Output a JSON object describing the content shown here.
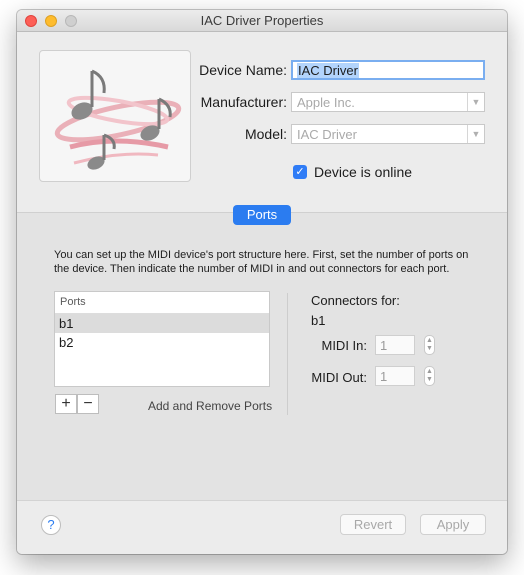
{
  "window": {
    "title": "IAC Driver Properties"
  },
  "device": {
    "name_label": "Device Name:",
    "name_value": "IAC Driver",
    "manufacturer_label": "Manufacturer:",
    "manufacturer_value": "Apple Inc.",
    "model_label": "Model:",
    "model_value": "IAC Driver",
    "online_label": "Device is online",
    "online_checked": true,
    "icon": "midi-notes-icon"
  },
  "tabs": {
    "ports_label": "Ports"
  },
  "description": "You can set up the MIDI device's port structure here. First, set the number of ports on the device. Then indicate the number of MIDI in and out connectors for each port.",
  "ports": {
    "header": "Ports",
    "items": [
      "b1",
      "b2"
    ],
    "selected": "b1",
    "add_symbol": "+",
    "remove_symbol": "−",
    "add_remove_label": "Add and Remove Ports"
  },
  "connectors": {
    "title": "Connectors for:",
    "port": "b1",
    "midi_in_label": "MIDI In:",
    "midi_in_value": "1",
    "midi_out_label": "MIDI Out:",
    "midi_out_value": "1"
  },
  "footer": {
    "help": "?",
    "revert": "Revert",
    "apply": "Apply"
  },
  "colors": {
    "accent": "#2b7cf0",
    "close": "#fd5f57",
    "minimize": "#febc2e",
    "zoom": "#cfcfcf"
  }
}
